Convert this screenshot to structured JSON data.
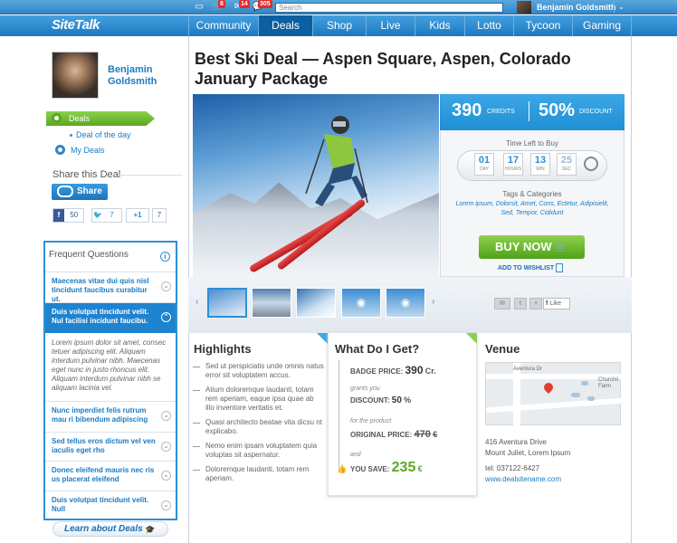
{
  "topbar": {
    "search_placeholder": "Search",
    "badges": [
      "8",
      "14",
      "305"
    ],
    "user": "Benjamin Goldsmith"
  },
  "nav": {
    "logo": "SiteTalk",
    "items": [
      "Community",
      "Deals",
      "Shop",
      "Live",
      "Kids",
      "Lotto",
      "Tycoon",
      "Gaming"
    ],
    "active": "Deals"
  },
  "sidebar": {
    "user_name": "Benjamin Goldsmith",
    "deals_label": "Deals",
    "deal_of_day": "Deal of the day",
    "my_deals": "My Deals",
    "share_title": "Share this Deal",
    "share_button": "Share",
    "fb_count": "50",
    "tw_count": "7",
    "gplus_label": "+1",
    "gplus_count": "7",
    "learn_label": "Learn about Deals"
  },
  "faq": {
    "title": "Frequent Questions",
    "items": [
      "Maecenas vitae dui quis nisl tincidunt faucibus curabitur ut.",
      "Duis volutpat tincidunt velit. Nul facilisi incidunt faucibu.",
      "Nunc imperdiet felis rutrum mau ri bibendum adipiscing",
      "Sed tellus eros dictum vel ven iaculis eget rho",
      "Donec eleifend mauris nec ris us placerat eleifend",
      "Duis volutpat tincidunt velit. Null"
    ],
    "answer": "Lorem ipsum dolor sit amet, consec tetuer adipiscing elit. Aliquam interdum pulvinar nibh. Maecenas eget nunc in justo rhoncus elit. Aliquam interdum pulvinar nibh se aliquam lacinia vel."
  },
  "deal": {
    "title": "Best Ski Deal — Aspen Square, Aspen, Colorado January Package",
    "credits": "390",
    "credits_label": "CREDITS",
    "discount": "50%",
    "discount_label": "DISCOUNT",
    "time_left_label": "Time Left to Buy",
    "timer": [
      {
        "num": "01",
        "label": "DAY"
      },
      {
        "num": "17",
        "label": "HOURS"
      },
      {
        "num": "13",
        "label": "MIN"
      },
      {
        "num": "25",
        "label": "SEC"
      }
    ],
    "tags_title": "Tags & Categories",
    "tags": "Lorem ipsum, Dolorsit, Amet, Cons, Ectetur, Adipisielit, Sed, Tempor, Cididunt",
    "buy_label": "BUY NOW",
    "wishlist_label": "ADD TO WISHLIST",
    "like_label": "Like"
  },
  "highlights": {
    "title": "Highlights",
    "items": [
      "Sed ut perspiciatis unde omnis natus error sit voluptatem accus.",
      "Atium doloremque laudanti, totam rem aperiam, eaque ipsa quae ab illo inventore veritatis et.",
      "Quasi architecto beatae vita dicsu nt explicabo.",
      "Nemo enim ipsam voluptatem quia voluptas sit aspernatur.",
      "Doloremque laudanti, totam rem aperiam."
    ]
  },
  "what": {
    "title": "What Do I Get?",
    "badge_label": "BADGE PRICE:",
    "badge_value": "390",
    "badge_unit": "Cr.",
    "grants": "grants you",
    "discount_label": "DISCOUNT:",
    "discount_value": "50",
    "discount_unit": "%",
    "for_product": "for the product",
    "original_label": "ORIGINAL PRICE:",
    "original_value": "470",
    "original_unit": "€",
    "and": "and",
    "save_label": "YOU SAVE:",
    "save_value": "235",
    "save_unit": "€"
  },
  "venue": {
    "title": "Venue",
    "map_street": "Aventura Dr",
    "map_church": "Churchil Farm",
    "address1": "416 Aventura Drive",
    "address2": "Mount Juliet, Lorem Ipsum",
    "tel": "tel: 037122-6427",
    "web": "www.dealsitename.com"
  },
  "colors": {
    "accent": "#2d8fd6",
    "green": "#5aa820",
    "save_green": "#5aa820"
  }
}
